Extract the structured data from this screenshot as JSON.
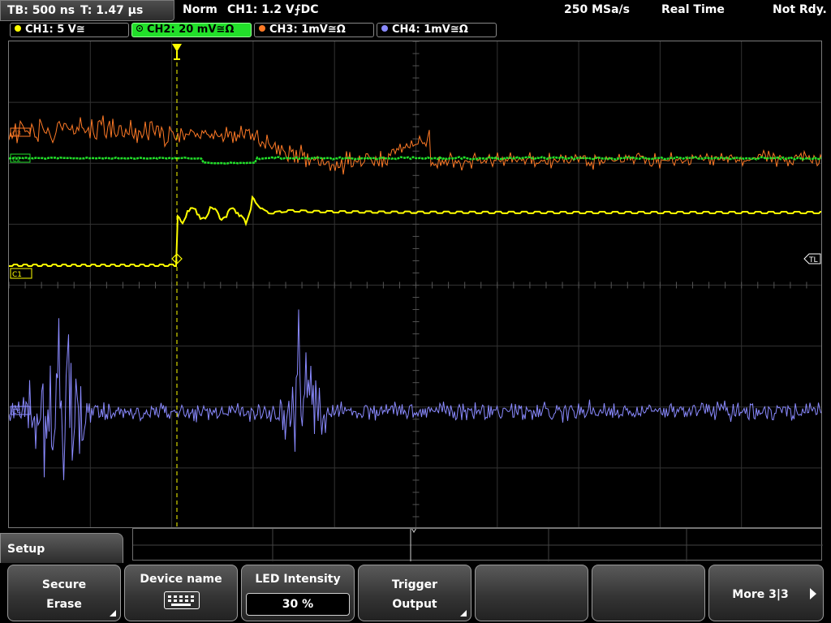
{
  "status": {
    "timebase": "TB: 500 ns",
    "trigger_time": "T: 1.47 µs",
    "acq_mode": "Norm",
    "trigger_source": "CH1: 1.2 V",
    "trigger_slope": "⨍DC",
    "sample_rate": "250 MSa/s",
    "run_mode": "Real Time",
    "state": "Not Rdy."
  },
  "channels": [
    {
      "label": "CH1: 5 V",
      "coupling": "≅",
      "color": "#ffff00",
      "active": false
    },
    {
      "label": "CH2: 20 mV",
      "coupling": "≅Ω",
      "color": "#22e02a",
      "active": true
    },
    {
      "label": "CH3: 1mV",
      "coupling": "≅Ω",
      "color": "#ff7a26",
      "active": false
    },
    {
      "label": "CH4: 1mV",
      "coupling": "≅Ω",
      "color": "#8a8aff",
      "active": false
    }
  ],
  "markers": {
    "ch1": "C1",
    "ch2": "C2",
    "ch3": "C3",
    "ch4": "C4",
    "trigger_level": "TL"
  },
  "menu": {
    "title": "Setup",
    "softkeys": [
      {
        "line1": "Secure",
        "line2": "Erase"
      },
      {
        "title": "Device name",
        "icon": "keyboard-icon"
      },
      {
        "title": "LED Intensity",
        "value": "30 %"
      },
      {
        "line1": "Trigger",
        "line2": "Output"
      },
      {},
      {},
      {
        "label": "More 3|3",
        "icon": "arrow-right-icon"
      }
    ]
  }
}
